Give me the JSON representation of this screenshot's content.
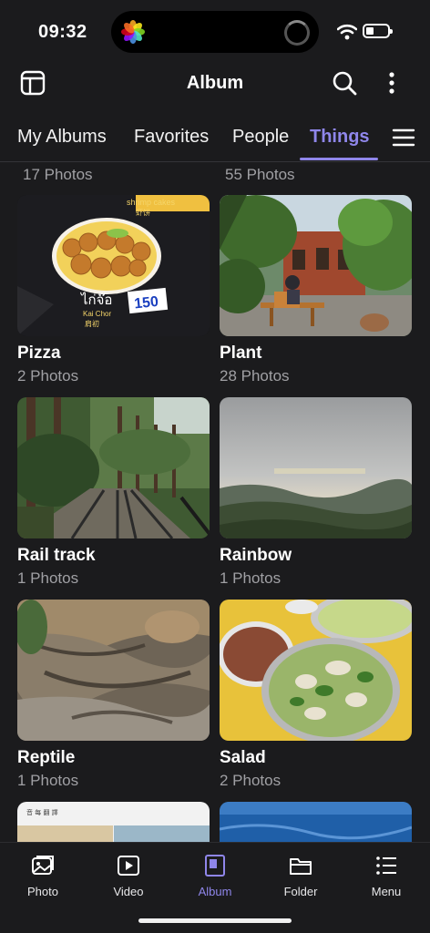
{
  "status_bar": {
    "time": "09:32"
  },
  "header": {
    "title": "Album",
    "icons": [
      "layout-icon",
      "search-icon",
      "more-vertical-icon"
    ]
  },
  "tabs": [
    {
      "label": "My Albums",
      "active": false
    },
    {
      "label": "Favorites",
      "active": false
    },
    {
      "label": "People",
      "active": false
    },
    {
      "label": "Things",
      "active": true
    }
  ],
  "partial_counts": [
    "17 Photos",
    "55 Photos"
  ],
  "albums": [
    {
      "name": "Pizza",
      "count": "2 Photos"
    },
    {
      "name": "Plant",
      "count": "28 Photos"
    },
    {
      "name": "Rail track",
      "count": "1 Photos"
    },
    {
      "name": "Rainbow",
      "count": "1 Photos"
    },
    {
      "name": "Reptile",
      "count": "1 Photos"
    },
    {
      "name": "Salad",
      "count": "2 Photos"
    }
  ],
  "thumb_text": {
    "pizza_top": "shrimp cakes",
    "pizza_cn": "虾饼",
    "pizza_thai": "ไก่จ๊อ",
    "pizza_sub": "Kai Chor",
    "pizza_cn2": "肩初",
    "pizza_price": "150",
    "doc_header": "音 每 翻 譯"
  },
  "bottom_nav": [
    {
      "label": "Photo",
      "icon": "photo-icon",
      "active": false
    },
    {
      "label": "Video",
      "icon": "video-icon",
      "active": false
    },
    {
      "label": "Album",
      "icon": "album-icon",
      "active": true
    },
    {
      "label": "Folder",
      "icon": "folder-icon",
      "active": false
    },
    {
      "label": "Menu",
      "icon": "menu-icon",
      "active": false
    }
  ],
  "colors": {
    "background": "#1b1b1d",
    "accent": "#8f86ea",
    "secondary_text": "#a0a0a4"
  }
}
